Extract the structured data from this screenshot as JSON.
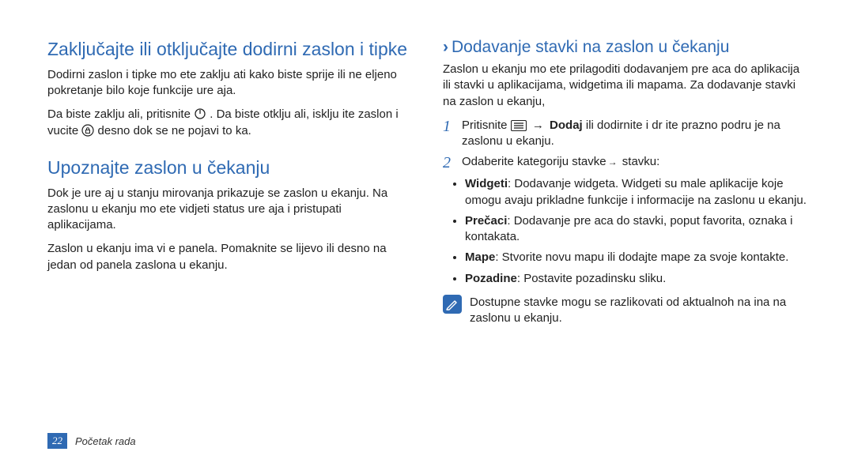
{
  "left": {
    "h_lock": "Zaključajte ili otključajte dodirni zaslon i tipke",
    "p_lock1": "Dodirni zaslon i tipke mo ete zaklju ati kako biste sprije ili ne eljeno pokretanje bilo koje funkcije ure aja.",
    "p_lock2_a": "Da biste zaklju ali, pritisnite ",
    "p_lock2_b": ". Da biste otklju ali, isklju ite zaslon i vucite ",
    "p_lock2_c": " desno dok se ne pojavi to ka.",
    "h_idle": "Upoznajte zaslon u čekanju",
    "p_idle1": "Dok je ure aj u stanju mirovanja prikazuje se zaslon u  ekanju. Na zaslonu u  ekanju mo ete vidjeti status ure aja i pristupati aplikacijama.",
    "p_idle2": "Zaslon u  ekanju ima vi e panela. Pomaknite se lijevo ili desno na jedan od panela zaslona u  ekanju."
  },
  "right": {
    "h_add": "Dodavanje stavki na zaslon u čekanju",
    "p_add_intro": "Zaslon u  ekanju mo ete prilagoditi dodavanjem pre aca do aplikacija ili stavki u aplikacijama, widgetima ili mapama. Za dodavanje stavki na zaslon u  ekanju,",
    "step1_a": "Pritisnite ",
    "step1_dodaj": "Dodaj",
    "step1_b": " ili dodirnite i dr ite prazno podru je na zaslonu u  ekanju.",
    "step2_a": "Odaberite kategoriju stavke",
    "step2_b": " stavku:",
    "bullets": {
      "widget_label": "Widgeti",
      "widget_text": ": Dodavanje widgeta. Widgeti su male aplikacije koje omogu avaju prikladne funkcije i informacije na zaslonu u  ekanju.",
      "shortcut_label": "Prečaci",
      "shortcut_text": ": Dodavanje pre aca do stavki, poput favorita, oznaka i kontakata.",
      "folder_label": "Mape",
      "folder_text": ": Stvorite novu mapu ili dodajte mape za svoje kontakte.",
      "wallpaper_label": "Pozadine",
      "wallpaper_text": ": Postavite pozadinsku sliku."
    },
    "note": "Dostupne stavke mogu se razlikovati od aktualnoh na ina na zaslonu u  ekanju."
  },
  "footer": {
    "page": "22",
    "section": "Početak rada"
  }
}
